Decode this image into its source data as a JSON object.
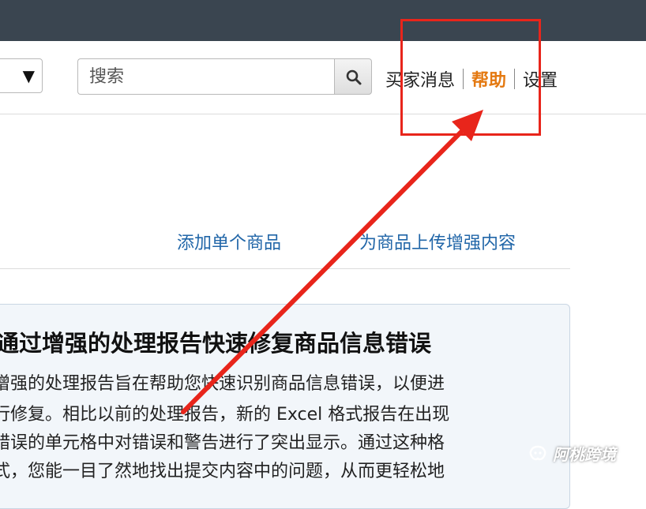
{
  "header": {
    "search": {
      "placeholder": "搜索"
    },
    "nav": {
      "buyer_messages": "买家消息",
      "help": "帮助",
      "settings": "设置"
    }
  },
  "links": {
    "add_single": "添加单个商品",
    "upload_enhanced": "为商品上传增强内容"
  },
  "info_panel": {
    "title": "通过增强的处理报告快速修复商品信息错误",
    "lines": [
      "增强的处理报告旨在帮助您快速识别商品信息错误，以便进",
      "行修复。相比以前的处理报告，新的 Excel 格式报告在出现",
      "错误的单元格中对错误和警告进行了突出显示。通过这种格",
      "式，您能一目了然地找出提交内容中的问题，从而更轻松地"
    ]
  },
  "watermark": {
    "text": "阿桃跨境"
  },
  "colors": {
    "topbar": "#3a4550",
    "help_accent": "#e47911",
    "link": "#2166a8",
    "annotation": "#e8251b"
  }
}
